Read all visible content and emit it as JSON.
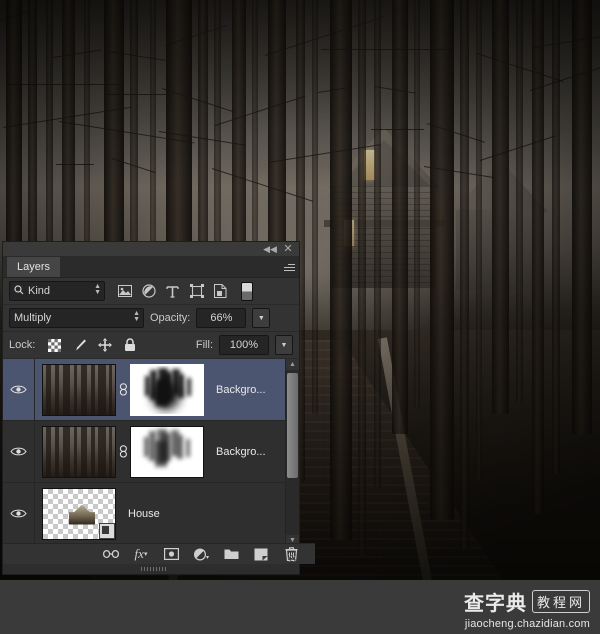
{
  "app": {
    "panel_title": "Layers",
    "window_controls": {
      "collapse": "◀◀",
      "close": "✕",
      "panel_menu": "panel-menu"
    }
  },
  "filter_row": {
    "kind_label": "Kind",
    "search_icon": "search-icon",
    "filter_icons": [
      "pixel-layer-filter",
      "adjustment-layer-filter",
      "type-layer-filter",
      "shape-layer-filter",
      "smart-object-filter"
    ],
    "toggle_name": "filter-enable-toggle"
  },
  "blend_row": {
    "blend_mode": "Multiply",
    "opacity_label": "Opacity:",
    "opacity_value": "66%"
  },
  "lock_row": {
    "lock_label": "Lock:",
    "lock_icons": [
      "lock-transparent-pixels",
      "lock-image-pixels",
      "lock-position",
      "lock-all"
    ],
    "fill_label": "Fill:",
    "fill_value": "100%"
  },
  "layers": [
    {
      "name": "Backgro...",
      "visible": true,
      "selected": true,
      "linked": true,
      "has_mask": true,
      "mask_selected": true,
      "thumb": "forest"
    },
    {
      "name": "Backgro...",
      "visible": true,
      "selected": false,
      "linked": true,
      "has_mask": true,
      "mask_selected": false,
      "thumb": "forest"
    },
    {
      "name": "House",
      "visible": true,
      "selected": false,
      "linked": false,
      "has_mask": false,
      "mask_selected": false,
      "thumb": "house-transparent"
    }
  ],
  "footer_buttons": [
    "link-layers-button",
    "layer-style-fx-button",
    "add-layer-mask-button",
    "new-adjustment-layer-button",
    "new-group-button",
    "new-layer-button",
    "delete-layer-button"
  ],
  "scrollbar": {
    "up_arrow": "▲",
    "down_arrow": "▼"
  },
  "watermark": {
    "cn_main": "查字典",
    "cn_box": "教程网",
    "url": "jiaocheng.chazidian.com"
  },
  "canvas": {
    "scene": "foggy-forest-with-abandoned-house",
    "accent_selected": "#4b5570",
    "panel_bg": "#333333"
  }
}
